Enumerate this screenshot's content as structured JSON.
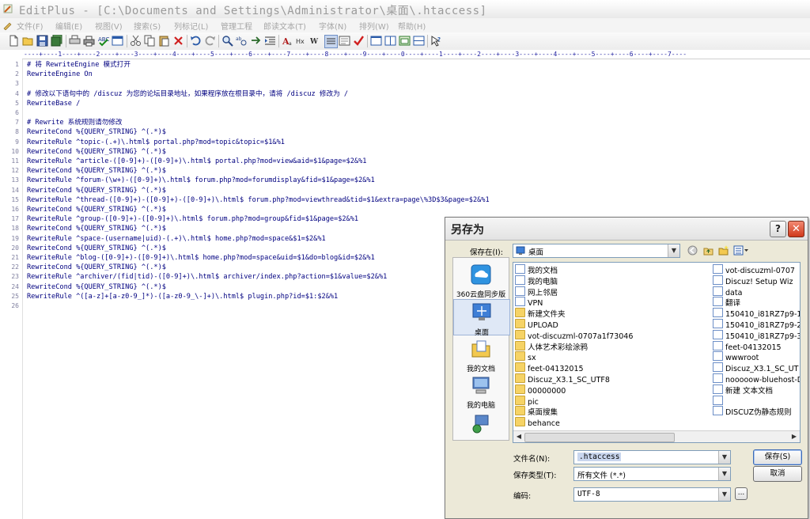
{
  "window": {
    "title": "EditPlus - [C:\\Documents and Settings\\Administrator\\桌面\\.htaccess]"
  },
  "menu": [
    "文件(F)",
    "编辑(E)",
    "视图(V)",
    "搜索(S)",
    "列标记(L)",
    "管理工程",
    "郎读文本(T)",
    "字体(N)",
    "排列(W)",
    "帮助(H)"
  ],
  "toolbar_icons": [
    "new-file-icon",
    "open-icon",
    "save-icon",
    "save-all-icon",
    "print-setup-icon",
    "print-icon",
    "spellcheck-icon",
    "browser-icon",
    "cut-icon",
    "copy-icon",
    "paste-icon",
    "delete-icon",
    "undo-icon",
    "redo-icon",
    "find-icon",
    "replace-icon",
    "goto-icon",
    "indent-icon",
    "font-icon",
    "hex-icon",
    "word-wrap-icon",
    "column-icon",
    "fullscreen-icon",
    "check-icon",
    "window1-icon",
    "window2-icon",
    "window3-icon",
    "window4-icon",
    "help-icon"
  ],
  "ruler": "----+----1----+----2----+----3----+----4----+----5----+----6----+----7----+----8----+----9----+----0----+----1----+----2----+----3----+----4----+----5----+----6----+----7----",
  "editor": {
    "lines": [
      "# 将 RewriteEngine 模式打开",
      "RewriteEngine On",
      "",
      "# 修改以下语句中的 /discuz 为您的论坛目录地址，如果程序放在根目录中，请将 /discuz 修改为 /",
      "RewriteBase /",
      "",
      "# Rewrite 系统规则请勿修改",
      "RewriteCond %{QUERY_STRING} ^(.*)$",
      "RewriteRule ^topic-(.+)\\.html$ portal.php?mod=topic&topic=$1&%1",
      "RewriteCond %{QUERY_STRING} ^(.*)$",
      "RewriteRule ^article-([0-9]+)-([0-9]+)\\.html$ portal.php?mod=view&aid=$1&page=$2&%1",
      "RewriteCond %{QUERY_STRING} ^(.*)$",
      "RewriteRule ^forum-(\\w+)-([0-9]+)\\.html$ forum.php?mod=forumdisplay&fid=$1&page=$2&%1",
      "RewriteCond %{QUERY_STRING} ^(.*)$",
      "RewriteRule ^thread-([0-9]+)-([0-9]+)-([0-9]+)\\.html$ forum.php?mod=viewthread&tid=$1&extra=page\\%3D$3&page=$2&%1",
      "RewriteCond %{QUERY_STRING} ^(.*)$",
      "RewriteRule ^group-([0-9]+)-([0-9]+)\\.html$ forum.php?mod=group&fid=$1&page=$2&%1",
      "RewriteCond %{QUERY_STRING} ^(.*)$",
      "RewriteRule ^space-(username|uid)-(.+)\\.html$ home.php?mod=space&$1=$2&%1",
      "RewriteCond %{QUERY_STRING} ^(.*)$",
      "RewriteRule ^blog-([0-9]+)-([0-9]+)\\.html$ home.php?mod=space&uid=$1&do=blog&id=$2&%1",
      "RewriteCond %{QUERY_STRING} ^(.*)$",
      "RewriteRule ^archiver/(fid|tid)-([0-9]+)\\.html$ archiver/index.php?action=$1&value=$2&%1",
      "RewriteCond %{QUERY_STRING} ^(.*)$",
      "RewriteRule ^([a-z]+[a-z0-9_]*)-([a-z0-9_\\-]+)\\.html$ plugin.php?id=$1:$2&%1",
      ""
    ]
  },
  "dialog": {
    "title": "另存为",
    "help_label": "?",
    "close_label": "✕",
    "save_in_label": "保存在(I):",
    "save_in_value": "桌面",
    "places": [
      {
        "label": "360云盘同步版",
        "icon": "cloud-sync-icon"
      },
      {
        "label": "桌面",
        "icon": "desktop-icon"
      },
      {
        "label": "我的文档",
        "icon": "my-documents-icon"
      },
      {
        "label": "我的电脑",
        "icon": "my-computer-icon"
      },
      {
        "label": "",
        "icon": "network-icon"
      }
    ],
    "files_col1": [
      {
        "name": "我的文档",
        "icon": "my-documents-icon"
      },
      {
        "name": "我的电脑",
        "icon": "my-computer-icon"
      },
      {
        "name": "网上邻居",
        "icon": "network-icon"
      },
      {
        "name": "VPN",
        "icon": "shortcut-icon"
      },
      {
        "name": "新建文件夹",
        "icon": "folder-icon"
      },
      {
        "name": "UPLOAD",
        "icon": "folder-icon"
      },
      {
        "name": "vot-discuzml-0707a1f73046",
        "icon": "folder-icon"
      },
      {
        "name": "人体艺术彩绘涂鸦",
        "icon": "folder-icon"
      },
      {
        "name": "sx",
        "icon": "folder-icon"
      },
      {
        "name": "feet-04132015",
        "icon": "folder-icon"
      },
      {
        "name": "Discuz_X3.1_SC_UTF8",
        "icon": "folder-icon"
      },
      {
        "name": "00000000",
        "icon": "folder-icon"
      },
      {
        "name": "pic",
        "icon": "folder-icon"
      },
      {
        "name": "桌面搜集",
        "icon": "folder-icon"
      },
      {
        "name": "behance",
        "icon": "folder-icon"
      }
    ],
    "files_col2": [
      {
        "name": "vot-discuzml-0707",
        "icon": "file-icon"
      },
      {
        "name": "Discuz! Setup Wiz",
        "icon": "setup-icon"
      },
      {
        "name": "data",
        "icon": "file-icon"
      },
      {
        "name": "翻译",
        "icon": "file-icon"
      },
      {
        "name": "150410_i81RZ7p9-1",
        "icon": "file-icon"
      },
      {
        "name": "150410_i81RZ7p9-2",
        "icon": "file-icon"
      },
      {
        "name": "150410_i81RZ7p9-3",
        "icon": "file-icon"
      },
      {
        "name": "feet-04132015",
        "icon": "file-icon"
      },
      {
        "name": "wwwroot",
        "icon": "file-icon"
      },
      {
        "name": "Discuz_X3.1_SC_UT",
        "icon": "file-icon"
      },
      {
        "name": "nooooow-bluehost-D",
        "icon": "file-icon"
      },
      {
        "name": "新建 文本文档",
        "icon": "file-icon"
      },
      {
        "name": "",
        "icon": "file-icon"
      },
      {
        "name": "DISCUZ伪静态规则",
        "icon": "file-icon"
      }
    ],
    "filename_label": "文件名(N):",
    "filename_value": ".htaccess",
    "filetype_label": "保存类型(T):",
    "filetype_value": "所有文件 (*.*)",
    "encoding_label": "编码:",
    "encoding_value": "UTF-8",
    "save_button": "保存(S)",
    "cancel_button": "取消",
    "more_button": "..."
  }
}
